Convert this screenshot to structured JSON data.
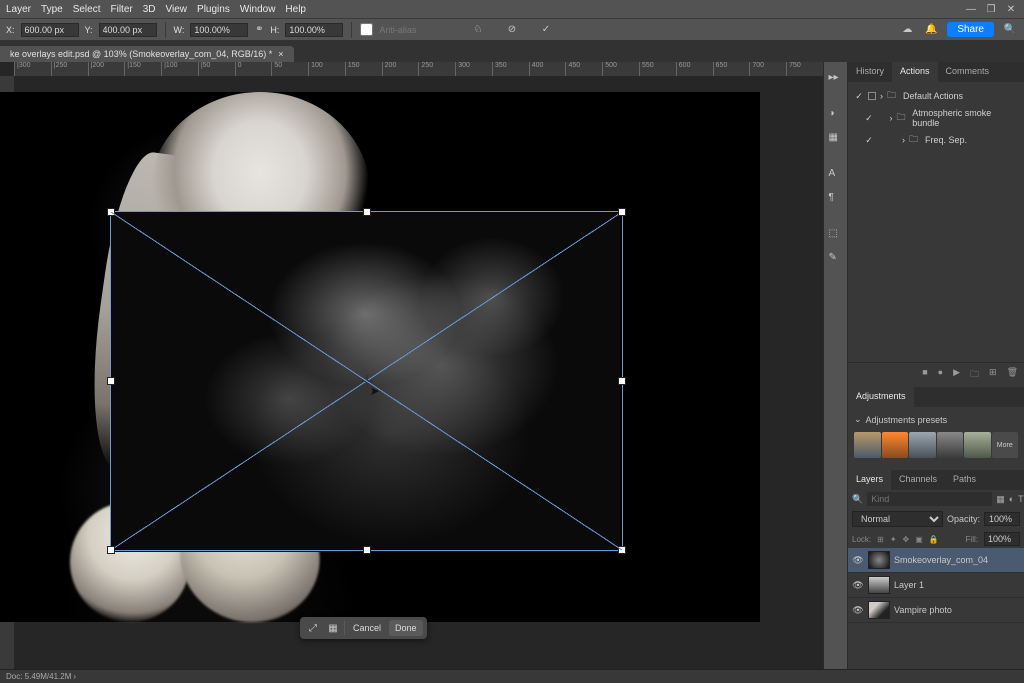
{
  "menubar": [
    "Layer",
    "Type",
    "Select",
    "Filter",
    "3D",
    "View",
    "Plugins",
    "Window",
    "Help"
  ],
  "optbar": {
    "x_label": "X:",
    "x_val": "600.00 px",
    "y_label": "Y:",
    "y_val": "400.00 px",
    "w_label": "W:",
    "w_val": "100.00%",
    "h_label": "H:",
    "h_val": "100.00%",
    "antialias": "Anti-alias",
    "share": "Share"
  },
  "doc_tab": {
    "title": "ke overlays edit.psd @ 103% (Smokeoverlay_com_04, RGB/16) *"
  },
  "ruler_marks": [
    "|300",
    "|250",
    "|200",
    "|150",
    "|100",
    "|50",
    "0",
    "50",
    "100",
    "150",
    "200",
    "250",
    "300",
    "350",
    "400",
    "450",
    "500",
    "550",
    "600",
    "650",
    "700",
    "750"
  ],
  "transform_bar": {
    "cancel": "Cancel",
    "done": "Done"
  },
  "panels": {
    "history_tab": "History",
    "actions_tab": "Actions",
    "comments_tab": "Comments",
    "actions": [
      {
        "name": "Default Actions"
      },
      {
        "name": "Atmospheric smoke bundle"
      },
      {
        "name": "Freq. Sep."
      }
    ],
    "adjustments_tab": "Adjustments",
    "adjustments_presets": "Adjustments presets",
    "preset_more": "More",
    "layers_tab": "Layers",
    "channels_tab": "Channels",
    "paths_tab": "Paths",
    "kind_label": "Kind",
    "blend_mode": "Normal",
    "opacity_label": "Opacity:",
    "opacity_val": "100%",
    "lock_label": "Lock:",
    "fill_label": "Fill:",
    "fill_val": "100%",
    "layers": [
      {
        "name": "Smokeoverlay_com_04",
        "selected": true,
        "thumb": "smoke"
      },
      {
        "name": "Layer 1",
        "selected": false,
        "thumb": "l1"
      },
      {
        "name": "Vampire photo",
        "selected": false,
        "thumb": "vp"
      }
    ]
  },
  "status": "Doc: 5.49M/41.2M"
}
